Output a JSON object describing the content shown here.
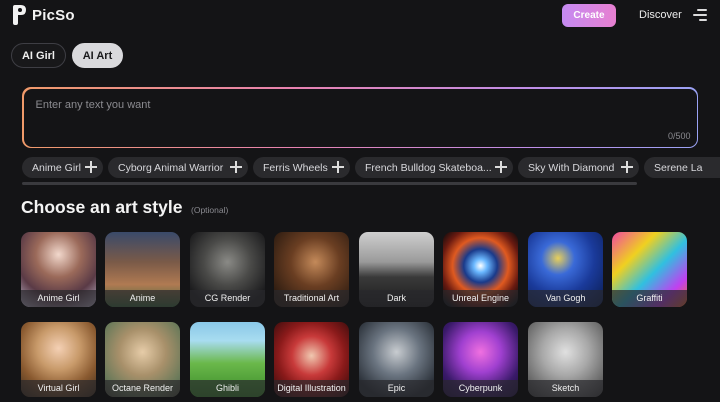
{
  "header": {
    "logo_text": "PicSo",
    "create_label": "Create",
    "discover_label": "Discover"
  },
  "tabs": [
    {
      "label": "AI Girl",
      "active": false
    },
    {
      "label": "AI Art",
      "active": true
    }
  ],
  "prompt": {
    "placeholder": "Enter any text you want",
    "counter": "0/500"
  },
  "suggestions": [
    "Anime Girl",
    "Cyborg Animal Warrior",
    "Ferris Wheels",
    "French Bulldog Skateboa...",
    "Sky With Diamond",
    "Serene La"
  ],
  "section": {
    "title": "Choose an art style",
    "optional": "(Optional)"
  },
  "styles_row1": [
    "Anime Girl",
    "Anime",
    "CG Render",
    "Traditional Art",
    "Dark",
    "Unreal Engine",
    "Van Gogh",
    "Graffiti"
  ],
  "styles_row2": [
    "Virtual Girl",
    "Octane Render",
    "Ghibli",
    "Digital Illustration",
    "Epic",
    "Cyberpunk",
    "Sketch"
  ],
  "colors": {
    "background": "#141416",
    "create_gradient_start": "#c58bf2",
    "create_gradient_end": "#e77fd0",
    "prompt_border_start": "#f09a6a",
    "prompt_border_end": "#9aa2f4",
    "chip_bg": "#2a2a2d"
  }
}
